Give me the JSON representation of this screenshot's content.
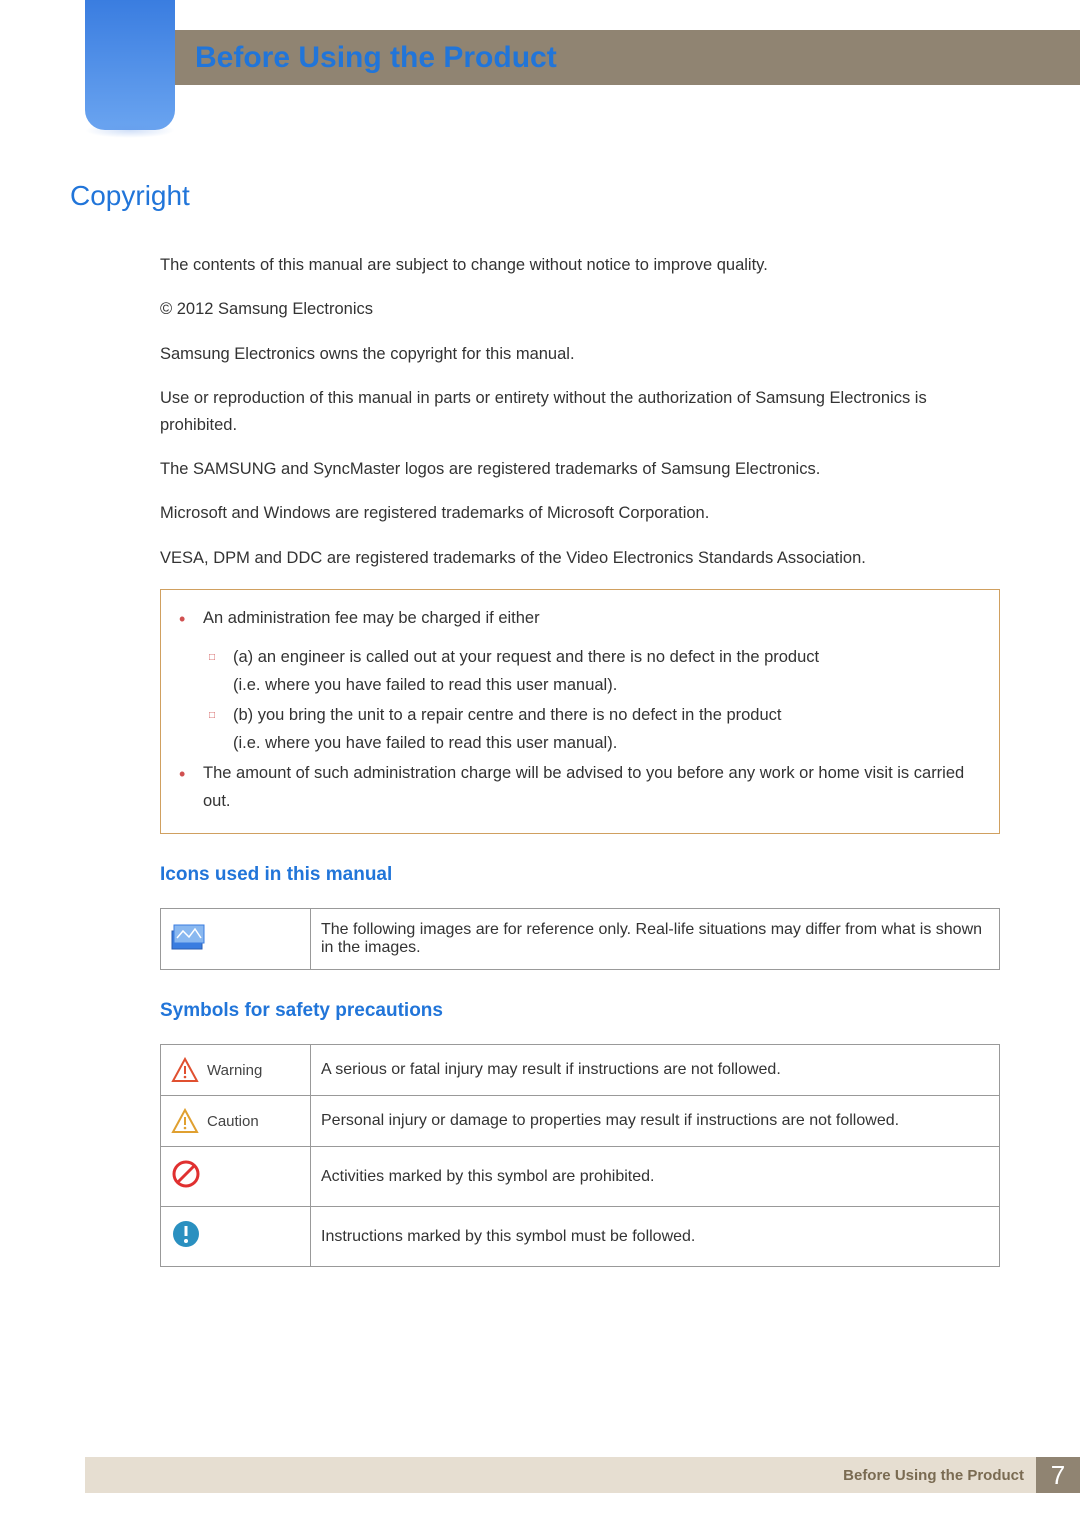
{
  "header": {
    "title": "Before Using the Product"
  },
  "section": {
    "title": "Copyright"
  },
  "paragraphs": {
    "p1": "The contents of this manual are subject to change without notice to improve quality.",
    "p2": "© 2012 Samsung Electronics",
    "p3": "Samsung Electronics owns the copyright for this manual.",
    "p4": "Use or reproduction of this manual in parts or entirety without the authorization of Samsung Electronics is prohibited.",
    "p5": "The SAMSUNG and SyncMaster logos are registered trademarks of Samsung Electronics.",
    "p6": "Microsoft and Windows are registered trademarks of Microsoft Corporation.",
    "p7": "VESA, DPM and DDC are registered trademarks of the Video Electronics Standards Association."
  },
  "fee_box": {
    "b1": "An administration fee may be charged if either",
    "b1a_line1": "(a) an engineer is called out at your request and there is no defect in the product",
    "b1a_line2": "(i.e. where you have failed to read this user manual).",
    "b1b_line1": "(b) you bring the unit to a repair centre and there is no defect in the product",
    "b1b_line2": "(i.e. where you have failed to read this user manual).",
    "b2": "The amount of such administration charge will be advised to you before any work or home visit is carried out."
  },
  "icons_section": {
    "title": "Icons used in this manual",
    "row1_desc": "The following images are for reference only. Real-life situations may differ from what is shown in the images."
  },
  "symbols_section": {
    "title": "Symbols for safety precautions",
    "warning_label": "Warning",
    "warning_desc": "A serious or fatal injury may result if instructions are not followed.",
    "caution_label": "Caution",
    "caution_desc": "Personal injury or damage to properties may result if instructions are not followed.",
    "prohibited_desc": "Activities marked by this symbol are prohibited.",
    "mustfollow_desc": "Instructions marked by this symbol must be followed."
  },
  "footer": {
    "label": "Before Using the Product",
    "page": "7"
  }
}
